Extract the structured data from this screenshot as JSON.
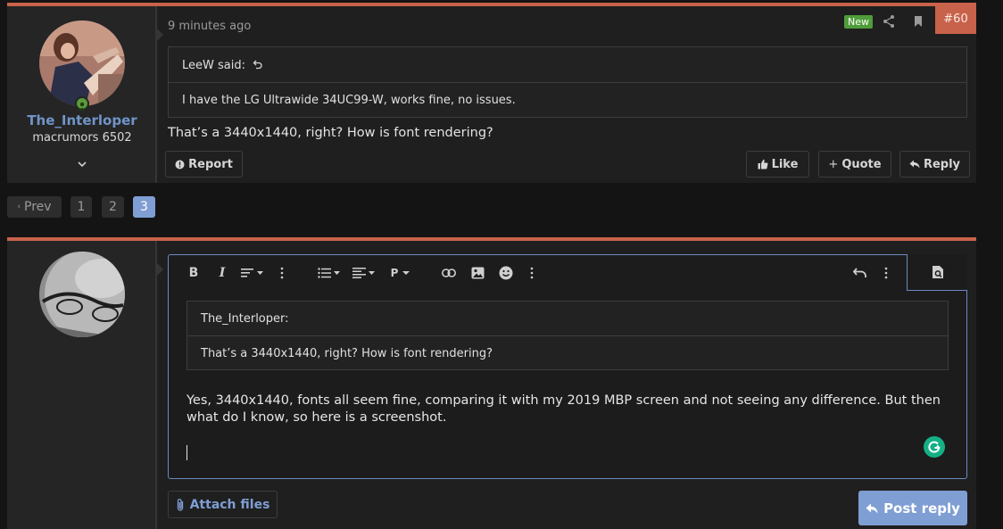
{
  "post": {
    "username": "The_Interloper",
    "user_title": "macrumors 6502",
    "timestamp": "9 minutes ago",
    "new_badge": "New",
    "post_number": "#60",
    "quote": {
      "author": "LeeW said:",
      "text": "I have the LG Ultrawide 34UC99-W, works fine, no issues."
    },
    "message": "That’s a 3440x1440, right? How is font rendering?",
    "actions": {
      "report": "Report",
      "like": "Like",
      "quote": "Quote",
      "reply": "Reply"
    }
  },
  "pagination": {
    "prev": "Prev",
    "pages": [
      "1",
      "2",
      "3"
    ],
    "current": "3"
  },
  "reply_editor": {
    "quote": {
      "author": "The_Interloper:",
      "text": "That’s a 3440x1440, right? How is font rendering?"
    },
    "draft_text": "Yes, 3440x1440, fonts all seem fine, comparing it with my 2019 MBP screen and not seeing any difference.  But then what do I know, so here is a screenshot.",
    "toolbar": {
      "paragraph_label": "P"
    },
    "attach_label": "Attach files",
    "post_reply_label": "Post reply"
  },
  "colors": {
    "accent": "#c8624a",
    "link": "#6f94c8",
    "button_primary": "#7f9ed3",
    "online": "#5a9b3a",
    "new_badge": "#4f9d3a"
  }
}
